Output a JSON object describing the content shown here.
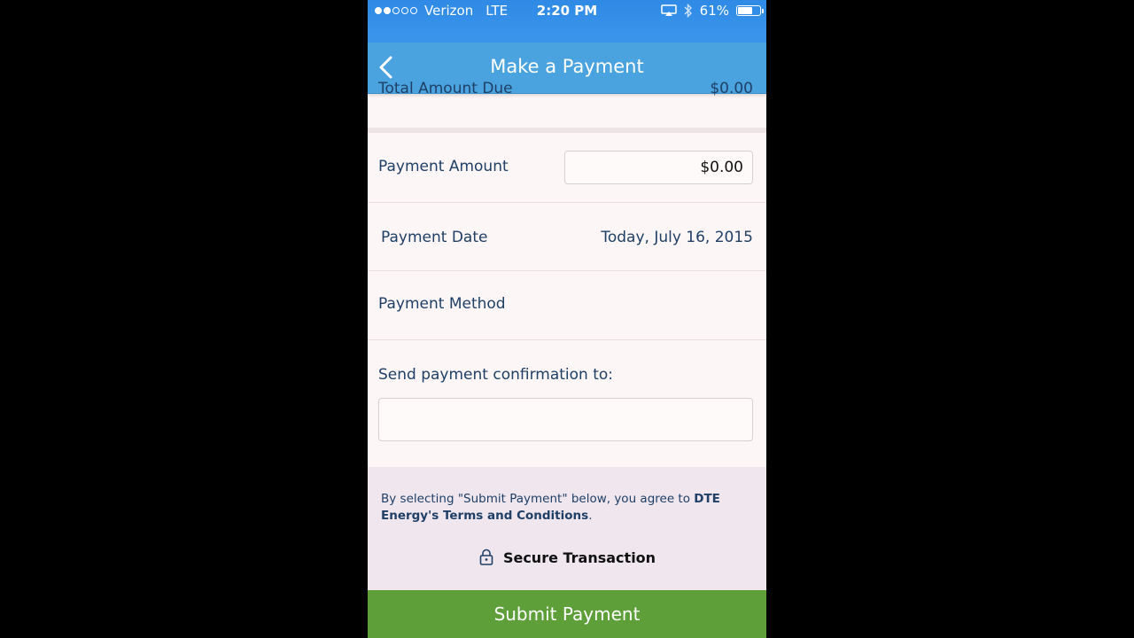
{
  "status_bar": {
    "carrier": "Verizon",
    "network": "LTE",
    "time": "2:20 PM",
    "battery": "61%",
    "signal_bars_filled": 2,
    "signal_bars_total": 5,
    "icons": [
      "airplay-icon",
      "bluetooth-icon",
      "battery-icon"
    ]
  },
  "nav": {
    "title": "Make a Payment",
    "back_icon": "chevron-left-icon"
  },
  "total": {
    "label": "Total Amount Due",
    "value": "$0.00"
  },
  "payment_amount": {
    "label": "Payment Amount",
    "value": "$0.00"
  },
  "payment_date": {
    "label": "Payment Date",
    "value": "Today, July 16, 2015"
  },
  "payment_method": {
    "label": "Payment Method"
  },
  "confirmation": {
    "label": "Send payment confirmation to:",
    "value": ""
  },
  "terms": {
    "prefix": "By selecting \"Submit Payment\" below, you agree to ",
    "link": "DTE Energy's Terms and Conditions",
    "suffix": "."
  },
  "secure": {
    "label": "Secure Transaction",
    "icon": "lock-icon"
  },
  "submit": {
    "label": "Submit Payment"
  },
  "colors": {
    "status_bar": "#2f8ae6",
    "nav_bar": "#4aa3de",
    "submit_button": "#5e9f3a",
    "text": "#1f3f66",
    "terms_background": "#efe6ee"
  }
}
